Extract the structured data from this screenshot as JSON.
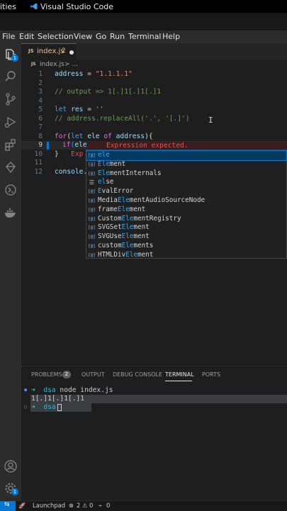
{
  "system_bar": {
    "activities_label": "ities",
    "app_title": "Visual Studio Code"
  },
  "menu": [
    "File",
    "Edit",
    "Selection",
    "View",
    "Go",
    "Run",
    "Terminal",
    "Help"
  ],
  "activity_bar": {
    "explorer_badge": "1",
    "settings_badge": "1"
  },
  "tab": {
    "icon": "JS",
    "filename": "index.js",
    "problem_count": "2"
  },
  "breadcrumb": {
    "icon": "JS",
    "file": "index.js",
    "more": "> ..."
  },
  "editor": {
    "line_numbers": [
      "1",
      "2",
      "3",
      "4",
      "5",
      "6",
      "7",
      "8",
      "9",
      "10",
      "11",
      "12"
    ],
    "lines": {
      "l1_var": "address",
      "l1_op": " = ",
      "l1_str": "\"1.1.1.1\"",
      "l3": "// output => 1[.]1[.]1[.]1",
      "l5_kw": "let",
      "l5_var": " res",
      "l5_op": " = ",
      "l5_str": "''",
      "l6": "// address.replaceAll('.', '[.]')",
      "l8_kw": "for",
      "l8_p1": "(",
      "l8_kw2": "let",
      "l8_ele": " ele",
      "l8_of": " of",
      "l8_addr": " address",
      "l8_p2": "){",
      "l9_kw": "if",
      "l9_p": "(",
      "l9_ele": "ele",
      "l10_br": "}",
      "l10_err": "Exp",
      "l12_var": "console."
    },
    "error_message": "Expression expected."
  },
  "suggestions": [
    {
      "kind": "abc",
      "pre": "",
      "hl": "ele",
      "post": ""
    },
    {
      "kind": "abc",
      "pre": "",
      "hl": "Ele",
      "post": "ment"
    },
    {
      "kind": "abc",
      "pre": "",
      "hl": "Ele",
      "post": "mentInternals"
    },
    {
      "kind": "kw",
      "pre": "",
      "hl": "el",
      "post": "se"
    },
    {
      "kind": "abc",
      "pre": "",
      "hl": "E",
      "post": "valError"
    },
    {
      "kind": "abc",
      "pre": "Media",
      "hl": "Ele",
      "post": "mentAudioSourceNode"
    },
    {
      "kind": "abc",
      "pre": "frame",
      "hl": "Ele",
      "post": "ment"
    },
    {
      "kind": "abc",
      "pre": "Custom",
      "hl": "Ele",
      "post": "mentRegistry"
    },
    {
      "kind": "abc",
      "pre": "SVGSet",
      "hl": "Ele",
      "post": "ment"
    },
    {
      "kind": "abc",
      "pre": "SVGUse",
      "hl": "Ele",
      "post": "ment"
    },
    {
      "kind": "abc",
      "pre": "custom",
      "hl": "Ele",
      "post": "ments"
    },
    {
      "kind": "abc",
      "pre": "HTMLDiv",
      "hl": "Ele",
      "post": "ment"
    }
  ],
  "panel": {
    "tabs": [
      "PROBLEMS",
      "OUTPUT",
      "DEBUG CONSOLE",
      "TERMINAL",
      "PORTS"
    ],
    "problems_count": "2"
  },
  "terminal": {
    "line1_dir": "dsa",
    "line1_cmd": " node index.js",
    "line2": "1[.]1[.]1[.]1",
    "line3_dir": "dsa"
  },
  "status_bar": {
    "launchpad": "Launchpad",
    "errors": "2",
    "warnings": "0",
    "ports": "0"
  },
  "colors": {
    "accent": "#0078d4",
    "error": "#f14c4c",
    "string": "#ce9178",
    "keyword": "#569cd6",
    "comment": "#6a9955"
  }
}
